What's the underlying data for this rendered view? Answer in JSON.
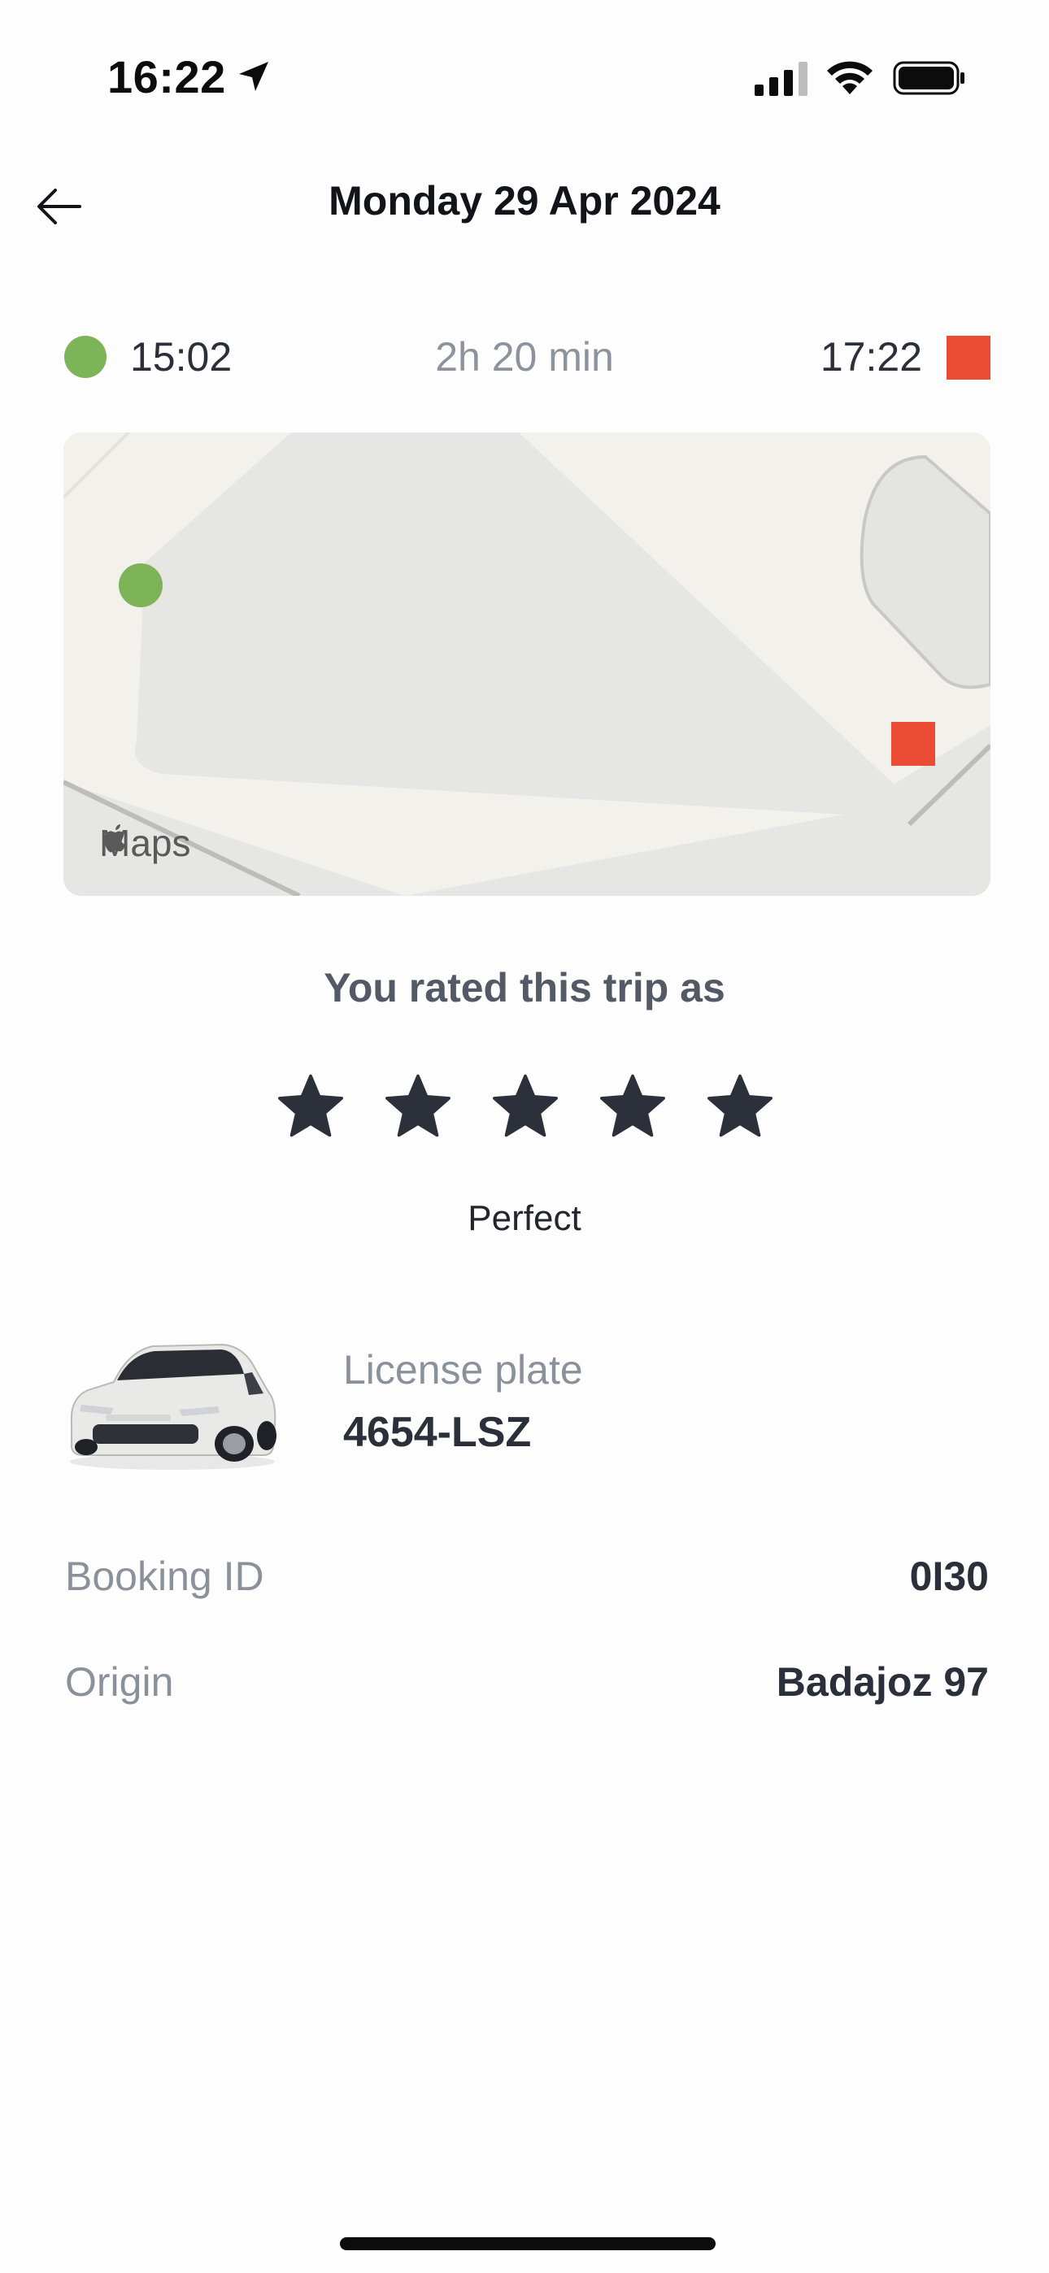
{
  "status_bar": {
    "time": "16:22",
    "location_icon": "location-arrow-icon",
    "signal_icon": "cellular-signal-icon",
    "wifi_icon": "wifi-icon",
    "battery_icon": "battery-icon"
  },
  "header": {
    "back_icon": "arrow-left-icon",
    "title": "Monday 29 Apr 2024"
  },
  "trip": {
    "start_time": "15:02",
    "duration": "2h 20 min",
    "end_time": "17:22",
    "start_color": "#7db457",
    "end_color": "#ea4d33"
  },
  "map": {
    "attribution": "Maps"
  },
  "rating": {
    "title": "You rated this trip as",
    "stars_filled": 5,
    "stars_total": 5,
    "label": "Perfect"
  },
  "vehicle": {
    "plate_label": "License plate",
    "plate_value": "4654-LSZ"
  },
  "details": {
    "booking_label": "Booking ID",
    "booking_value": "0I30",
    "origin_label": "Origin",
    "origin_value": "Badajoz 97"
  }
}
